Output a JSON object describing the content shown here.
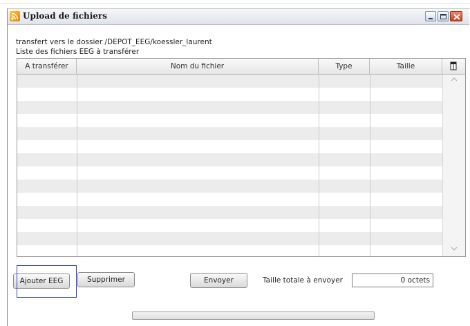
{
  "window": {
    "title": "Upload de fichiers"
  },
  "info": {
    "destination": "transfert vers le dossier  /DEPOT_EEG/koessler_laurent",
    "list_title": "Liste des fichiers EEG à transférer"
  },
  "table": {
    "columns": [
      "A transférer",
      "Nom du fichier",
      "Type",
      "Taille"
    ],
    "rows": [],
    "visible_empty_rows": 14
  },
  "buttons": {
    "add": "Ajouter EEG",
    "delete": "Supprimer",
    "send": "Envoyer"
  },
  "total": {
    "label": "Taille totale à envoyer",
    "value": "0 octets"
  },
  "progress": {
    "fraction": 0
  },
  "icons": {
    "app": "rss-feed-icon",
    "minimize": "minimize-icon",
    "maximize": "maximize-icon",
    "close": "close-icon",
    "column_chooser": "column-chooser-icon",
    "scroll_up": "chevron-up-icon",
    "scroll_down": "chevron-down-icon"
  },
  "colors": {
    "focus_outline": "#2f3fd0",
    "close_button": "#c9401e"
  }
}
